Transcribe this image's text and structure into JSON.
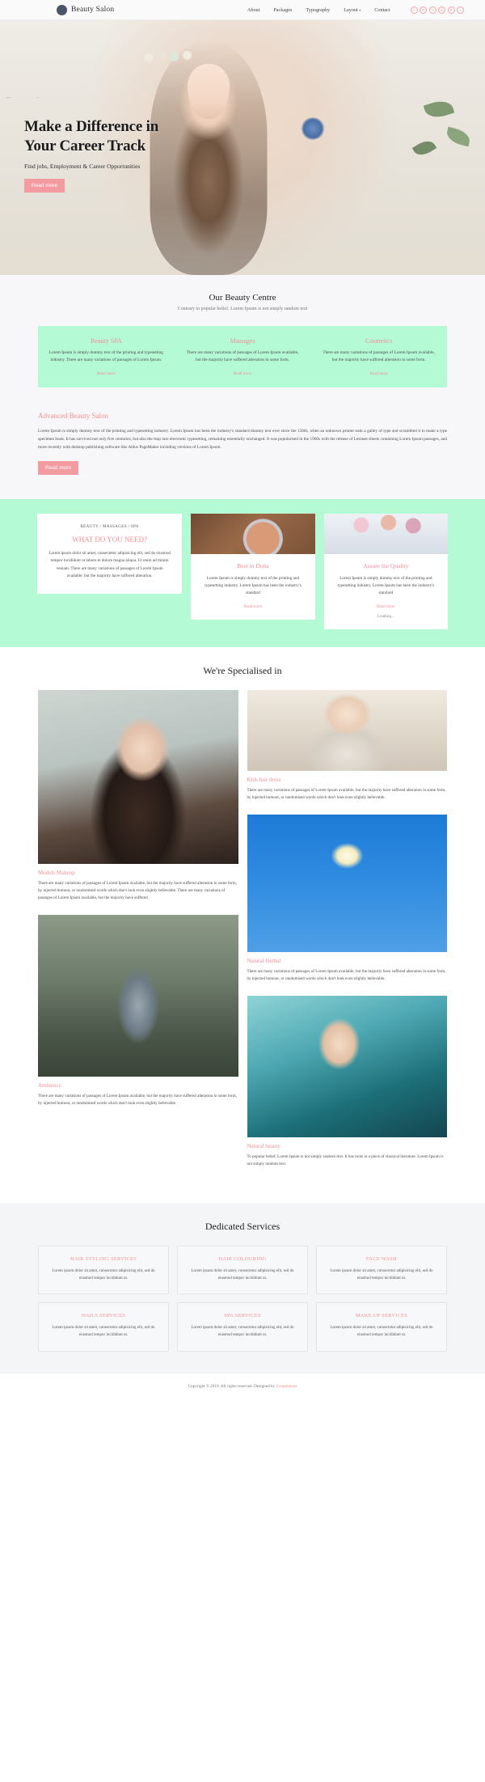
{
  "header": {
    "brand": "Beauty Salon",
    "nav": [
      {
        "label": "About",
        "caret": false
      },
      {
        "label": "Packages",
        "caret": false
      },
      {
        "label": "Typography",
        "caret": false
      },
      {
        "label": "Layout",
        "caret": true
      },
      {
        "label": "Contact",
        "caret": false
      }
    ],
    "socials": [
      "f",
      "G",
      "t",
      "in",
      "P",
      "r"
    ]
  },
  "hero": {
    "title_line1": "Make a Difference in",
    "title_line2": "Your Career Track",
    "subtitle": "Find jobs, Employment & Career Opportunities",
    "button": "Read more"
  },
  "centre": {
    "title": "Our Beauty Centre",
    "subtitle": "Contrary to popular belief, Lorem Ipsum is not simply random text",
    "cards": [
      {
        "title": "Beauty SPA",
        "body": "Lorem Ipsum is simply dummy text of the printing and typesetting industry. There are many variations of passages of Lorem Ipsum.",
        "link": "Read more"
      },
      {
        "title": "Massages",
        "body": "There are many variations of passages of Lorem Ipsum available, but the majority have suffered alteration in some form.",
        "link": "Read more"
      },
      {
        "title": "Cosmetics",
        "body": "There are many variations of passages of Lorem Ipsum available, but the majority have suffered alteration in some form.",
        "link": "Read more"
      }
    ]
  },
  "advanced": {
    "title": "Advanced Beauty Salon",
    "body": "Lorem Ipsum is simply dummy text of the printing and typesetting industry. Lorem Ipsum has been the industry's standard dummy text ever since the 1500s, when an unknown printer took a galley of type and scrambled it to make a type specimen book. It has survived not only five centuries, but also the leap into electronic typesetting, remaining essentially unchanged. It was popularised in the 1960s with the release of Letraset sheets containing Lorem Ipsum passages, and more recently with desktop publishing software like Aldus PageMaker including versions of Lorem Ipsum.",
    "button": "Read more"
  },
  "mint": {
    "card1": {
      "kicker": "BEAUTY / MASSAGES / SPA",
      "title": "WHAT DO YOU NEED?",
      "body": "Lorem ipsum dolor sit amet, consectetur adipisicing elit, sed do eiusmod tempor incididunt ut labore et dolore magna aliqua. Ut enim ad minim veniam. There are many variations of passages of Lorem Ipsum available, but the majority have suffered alteration."
    },
    "card2": {
      "image": "powder-compact-image",
      "title": "Best in Doha",
      "body": "Lorem Ipsum is simply dummy text of the printing and typesetting industry. Lorem Ipsum has been the industry's standard",
      "link": "Read more"
    },
    "card3": {
      "image": "makeup-brushes-image",
      "title": "Assure the Quality",
      "body": "Lorem Ipsum is simply dummy text of the printing and typesetting industry. Lorem Ipsum has been the industry's standard",
      "link": "Read more",
      "loading": "Loading..."
    }
  },
  "specialised": {
    "title": "We're Specialised in",
    "left": [
      {
        "image": "models-makeup-image",
        "title": "Models Makeup",
        "body": "There are many variations of passages of Lorem Ipsum available, but the majority have suffered alteration in some form, by injected humour, or randomised words which don't look even slightly believable. There are many variations of passages of Lorem Ipsum available, but the majority have suffered ."
      },
      {
        "image": "ambience-swing-image",
        "title": "Ambience",
        "body": "There are many variations of passages of Lorem Ipsum available, but the majority have suffered alteration in some form, by injected humour, or randomised words which don't look even slightly believable."
      }
    ],
    "right": [
      {
        "image": "kids-hair-dress-image",
        "title": "Kids hair dress",
        "body": "There are many variations of passages of Lorem Ipsum available, but the majority have suffered alteration in some form, by injected humour, or randomised words which don't look even slightly believable."
      },
      {
        "image": "natural-herbal-flower-image",
        "title": "Natural Herbal",
        "body": "There are many variations of passages of Lorem Ipsum available, but the majority have suffered alteration in some form, by injected humour, or randomised words which don't look even slightly believable."
      },
      {
        "image": "natural-beauty-image",
        "title": "Natural beauty",
        "body": "To popular belief, Lorem Ipsum is not simply random text. It has roots in a piece of classical literature. Lorem Ipsum is not simply random text."
      }
    ]
  },
  "dedicated": {
    "title": "Dedicated Services",
    "items": [
      {
        "name": "HAIR STYLING SERVICES",
        "body": "Lorem ipsum dolor sit amet, consectetur adipisicing elit, sed do eiusmod tempor incididunt ut."
      },
      {
        "name": "HAIR COLOURING",
        "body": "Lorem ipsum dolor sit amet, consectetur adipisicing elit, sed do eiusmod tempor incididunt ut."
      },
      {
        "name": "FACE WASH",
        "body": "Lorem ipsum dolor sit amet, consectetur adipisicing elit, sed do eiusmod tempor incididunt ut."
      },
      {
        "name": "NAILS SERVICES",
        "body": "Lorem ipsum dolor sit amet, consectetur adipisicing elit, sed do eiusmod tempor incididunt ut."
      },
      {
        "name": "SPA SERVICES",
        "body": "Lorem ipsum dolor sit amet, consectetur adipisicing elit, sed do eiusmod tempor incididunt ut."
      },
      {
        "name": "MAKE UP SERVICES",
        "body": "Lorem ipsum dolor sit amet, consectetur adipisicing elit, sed do eiusmod tempor incididunt ut."
      }
    ]
  },
  "footer": {
    "copyright": "Copyright © 2019. All rights reserved. Designed by ",
    "designer": "Zymphonies"
  },
  "colors": {
    "accent_pink": "#f58f96",
    "mint": "#b3fad5",
    "panel_gray": "#f7f7f9"
  }
}
